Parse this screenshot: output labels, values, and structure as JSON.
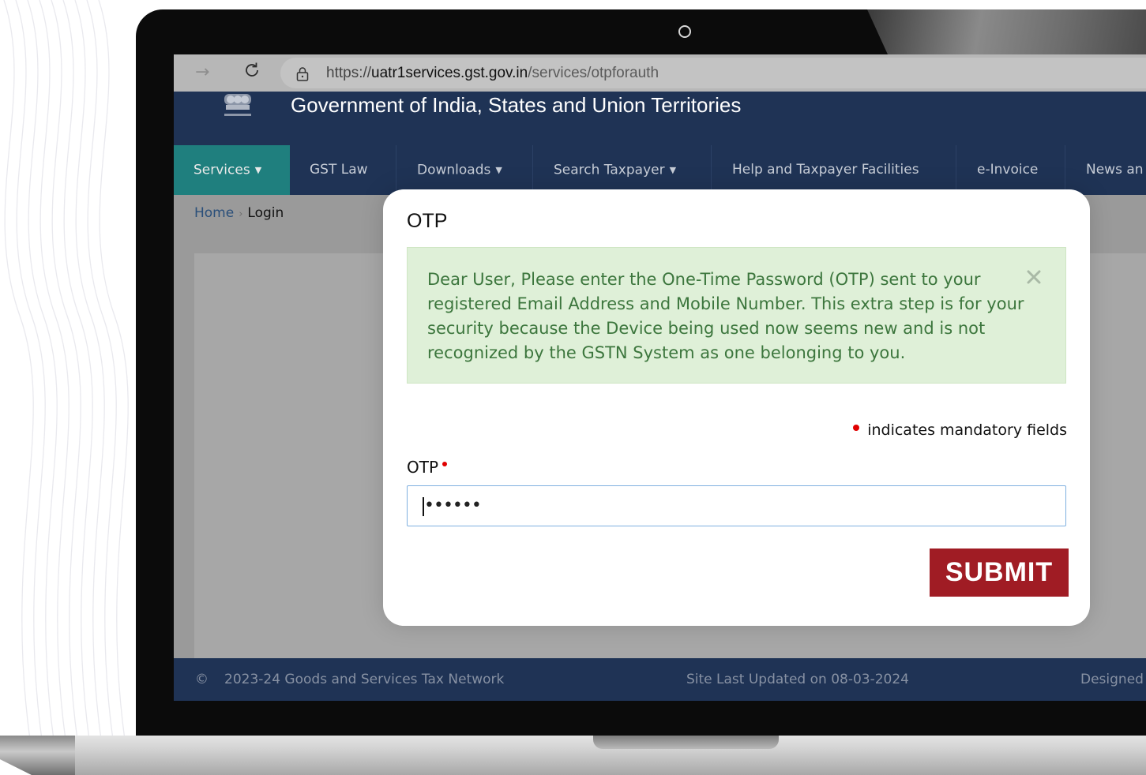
{
  "browser": {
    "url_scheme": "https://",
    "url_domain": "uatr1services.gst.gov.in",
    "url_path": "/services/otpforauth"
  },
  "header": {
    "title": "Government of India, States and Union Territories"
  },
  "nav": {
    "items": [
      {
        "label": "Services",
        "active": true,
        "dropdown": true
      },
      {
        "label": "GST Law",
        "active": false,
        "dropdown": false
      },
      {
        "label": "Downloads",
        "active": false,
        "dropdown": true
      },
      {
        "label": "Search Taxpayer",
        "active": false,
        "dropdown": true
      },
      {
        "label": "Help and Taxpayer Facilities",
        "active": false,
        "dropdown": false
      },
      {
        "label": "e-Invoice",
        "active": false,
        "dropdown": false
      },
      {
        "label": "News an",
        "active": false,
        "dropdown": false
      }
    ]
  },
  "breadcrumb": {
    "home": "Home",
    "current": "Login"
  },
  "modal": {
    "title": "OTP",
    "alert_message": "Dear User, Please enter the One-Time Password (OTP) sent to your registered Email Address and Mobile Number. This extra step is for your security because the Device being used now seems new and is not recognized by the GSTN System as one belonging to you.",
    "mandatory_note": "indicates mandatory fields",
    "otp_label": "OTP",
    "otp_value": "••••••",
    "submit_label": "SUBMIT"
  },
  "footer": {
    "copyright_symbol": "©",
    "copyright": "2023-24  Goods and Services Tax Network",
    "last_updated": "Site Last Updated on 08-03-2024",
    "designed": "Designed"
  },
  "colors": {
    "navy": "#1f3355",
    "teal_active": "#1f7f7e",
    "alert_bg": "#dff0d8",
    "alert_text": "#3c763d",
    "submit_bg": "#a01c24",
    "required_dot": "#e00000"
  }
}
